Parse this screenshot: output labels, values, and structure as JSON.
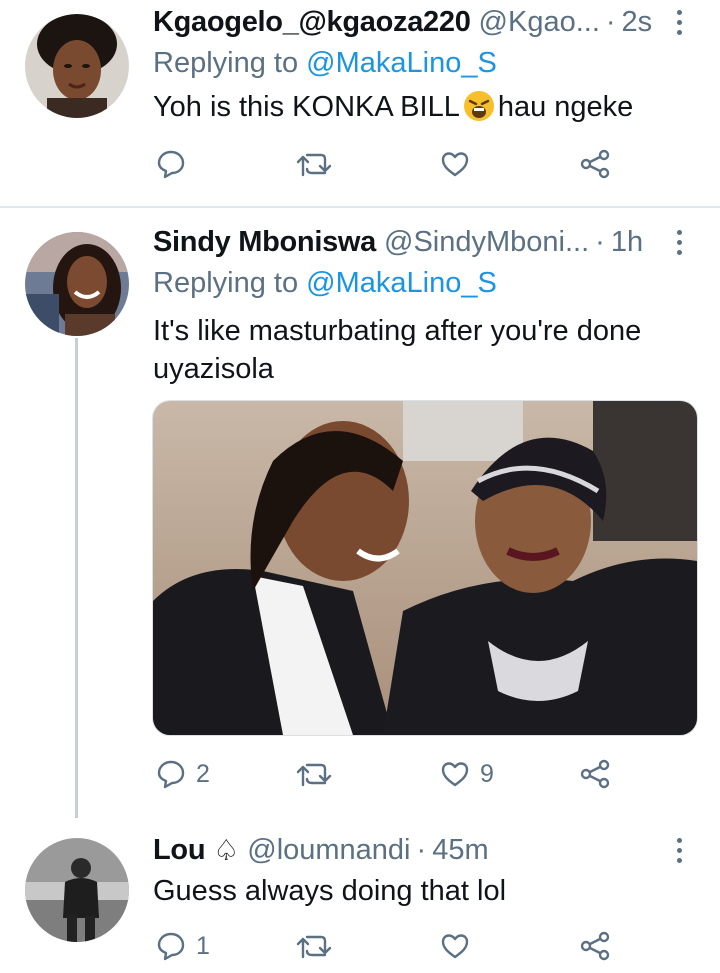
{
  "tweets": [
    {
      "name": "Kgaogelo_@kgaoza220",
      "handle": "@Kgao...",
      "dot": "·",
      "time": "2s",
      "replying_prefix": "Replying to",
      "replying_to": "@MakaLino_S",
      "text_before": "Yoh is this KONKA BILL",
      "emoji": "weary-face",
      "text_after": "hau ngeke",
      "actions": {
        "reply": "",
        "retweet": "",
        "like": ""
      }
    },
    {
      "name": "Sindy Mboniswa",
      "handle": "@SindyMboni...",
      "dot": "·",
      "time": "1h",
      "replying_prefix": "Replying to",
      "replying_to": "@MakaLino_S",
      "text": "It's like masturbating after you're done uyazisola",
      "actions": {
        "reply": "2",
        "retweet": "",
        "like": "9"
      }
    },
    {
      "name": "Lou",
      "badge": "♤",
      "handle": "@loumnandi",
      "dot": "·",
      "time": "45m",
      "text": "Guess always doing that lol",
      "actions": {
        "reply": "1",
        "retweet": "",
        "like": ""
      }
    }
  ],
  "colors": {
    "secondary_text": "#5b7083",
    "link": "#1b95e0",
    "primary_text": "#0f1419",
    "divider": "#e1e8ed",
    "thread_line": "#c4cfd6"
  },
  "icons": [
    "reply-icon",
    "retweet-icon",
    "like-icon",
    "share-icon",
    "more-icon"
  ]
}
